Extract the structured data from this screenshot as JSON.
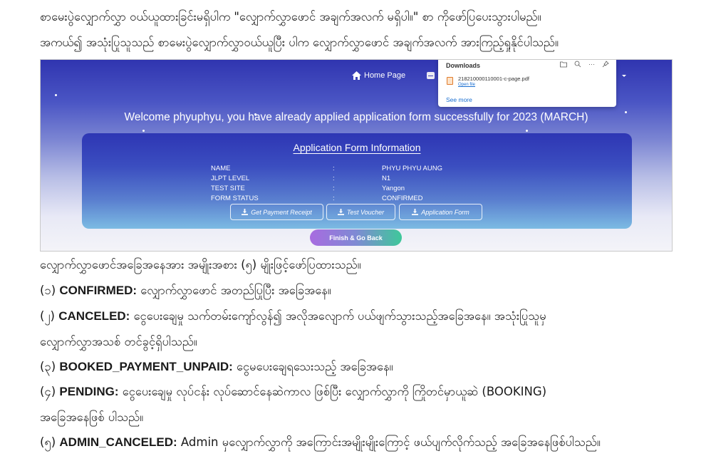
{
  "intro": {
    "line1": "        စာမေးပွဲလျှောက်လွှာ ဝယ်ယူထားခြင်းမရှိပါက \"လျှောက်လွှာဖောင် အချက်အလက် မရှိပါ။\" စာ ကိုဖော်ပြပေးသွားပါမည်။",
    "line2": "အကယ်၍ အသုံးပြုသူသည် စာမေးပွဲလျှောက်လွှာဝယ်ယူပြီး ပါက လျှောက်လွှာဖောင် အချက်အလက် အားကြည့်ရှုနိုင်ပါသည်။"
  },
  "screenshot": {
    "nav": {
      "home_label": "Home Page"
    },
    "welcome": "Welcome phyuphyu, you have already applied application form successfully for 2023 (MARCH)",
    "card": {
      "title": "Application Form Information",
      "rows": [
        {
          "label": "NAME",
          "sep": ":",
          "value": "PHYU PHYU AUNG"
        },
        {
          "label": "JLPT LEVEL",
          "sep": ":",
          "value": "N1"
        },
        {
          "label": "TEST SITE",
          "sep": ":",
          "value": "Yangon"
        },
        {
          "label": "FORM STATUS",
          "sep": ":",
          "value": "CONFIRMED"
        }
      ],
      "buttons": [
        "Get Payment Receipt",
        "Test Voucher",
        "Application Form"
      ]
    },
    "finish_button": "Finish & Go Back",
    "downloads": {
      "title": "Downloads",
      "file_name": "218210000110001-c-page.pdf",
      "open_file": "Open file",
      "see_more": "See more"
    }
  },
  "statuses": {
    "heading": "လျှောက်လွှာဖောင်အခြေအနေအား အမျိုးအစား (၅) မျိုးဖြင့်ဖော်ပြထားသည်။",
    "items": [
      {
        "num": "(၁) ",
        "key": "CONFIRMED:",
        "desc": "  လျှောက်လွှာဖောင် အတည်ပြုပြီး အခြေအနေ။",
        "desc2": ""
      },
      {
        "num": "(၂) ",
        "key": "CANCELED:",
        "desc": " ငွေပေးချေမှု သက်တမ်းကျော်လွန်၍ အလိုအလျောက် ပယ်ဖျက်သွားသည့်အခြေအနေ။ အသုံးပြုသူမှ",
        "desc2": "လျှောက်လွှာအသစ် တင်ခွင့်ရှိပါသည်။"
      },
      {
        "num": "(၃) ",
        "key": "BOOKED_PAYMENT_UNPAID:",
        "desc": " ငွေမပေးချေရသေးသည့် အခြေအနေ။",
        "desc2": ""
      },
      {
        "num": "(၄) ",
        "key": "PENDING:",
        "desc": " ငွေပေးချေမှု လုပ်ငန်း လုပ်ဆောင်နေဆဲကာလ ဖြစ်ပြီး လျှောက်လွှာကို ကြိုတင်မှာယူဆဲ (BOOKING)",
        "desc2": "အခြေအနေဖြစ် ပါသည်။"
      },
      {
        "num": "(၅) ",
        "key": "ADMIN_CANCELED:",
        "desc": "  Admin မှလျှောက်လွှာကို အကြောင်းအမျိုးမျိုးကြောင့် ဖယ်ပျက်လိုက်သည့် အခြေအနေဖြစ်ပါသည်။",
        "desc2": ""
      }
    ]
  }
}
